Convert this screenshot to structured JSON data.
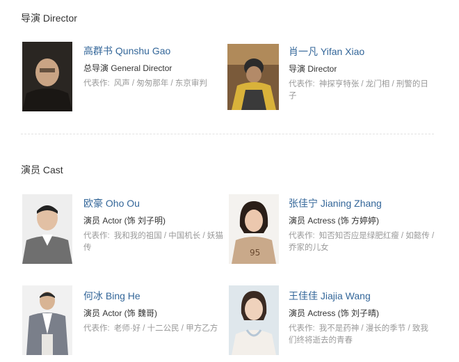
{
  "sections": {
    "directors_title": "导演 Director",
    "cast_title": "演员 Cast"
  },
  "directors": [
    {
      "name": "高群书 Qunshu Gao",
      "role": "总导演 General Director",
      "works_prefix": "代表作:",
      "works": "风声 / 匆匆那年 / 东京审判"
    },
    {
      "name": "肖一凡 Yifan Xiao",
      "role": "导演 Director",
      "works_prefix": "代表作:",
      "works": "神探亨特张 / 龙门相 / 刑警的日子"
    }
  ],
  "cast": [
    {
      "name": "欧豪 Oho Ou",
      "role": "演员 Actor (饰 刘子明)",
      "works_prefix": "代表作:",
      "works": "我和我的祖国 / 中国机长 / 妖猫传"
    },
    {
      "name": "张佳宁 Jianing Zhang",
      "role": "演员 Actress (饰 方婷婷)",
      "works_prefix": "代表作:",
      "works": "知否知否应是绿肥红瘦 / 如懿传 / 乔家的儿女"
    },
    {
      "name": "何冰 Bing He",
      "role": "演员 Actor (饰 魏哥)",
      "works_prefix": "代表作:",
      "works": "老师·好 / 十二公民 / 甲方乙方"
    },
    {
      "name": "王佳佳 Jiajia Wang",
      "role": "演员 Actress (饰 刘子晴)",
      "works_prefix": "代表作:",
      "works": "我不是药神 / 漫长的季节 / 致我们终将逝去的青春"
    }
  ]
}
